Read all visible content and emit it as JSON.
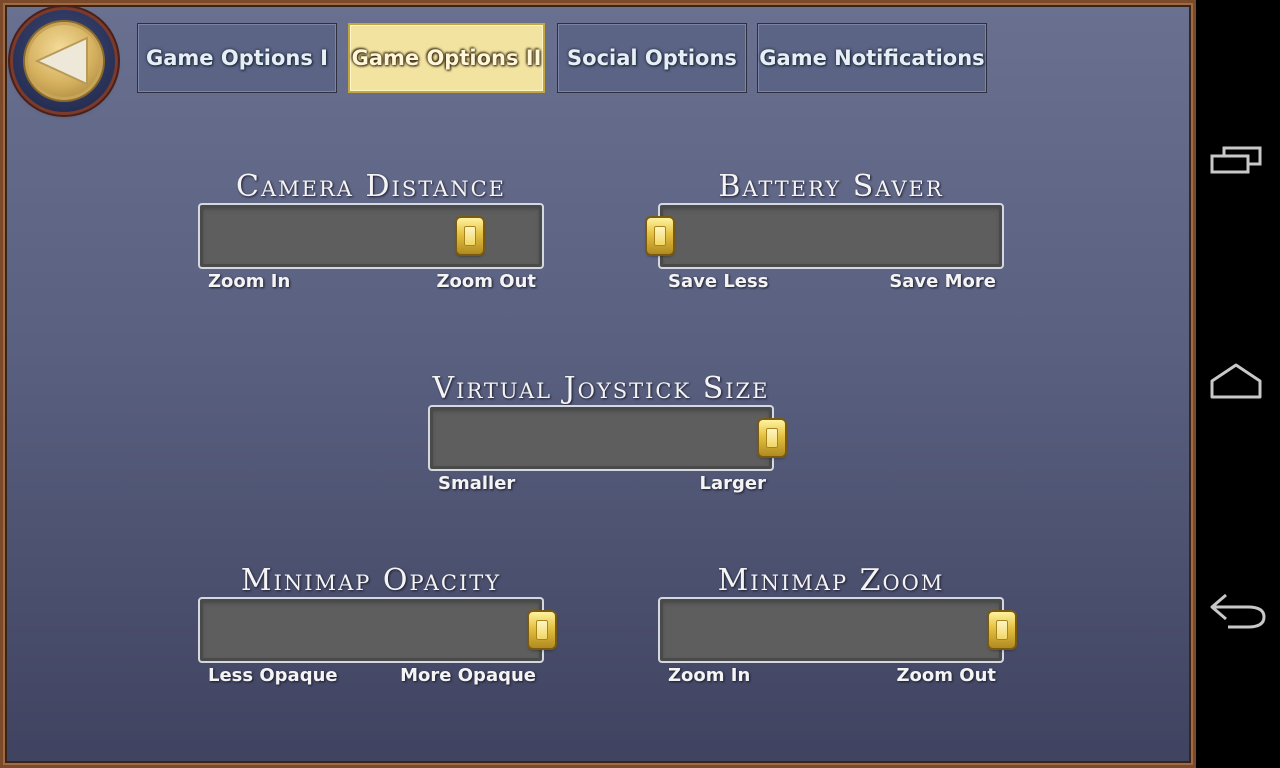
{
  "tabs": [
    {
      "id": "game-options-1",
      "label": "Game Options I",
      "active": false
    },
    {
      "id": "game-options-2",
      "label": "Game Options II",
      "active": true
    },
    {
      "id": "social-options",
      "label": "Social Options",
      "active": false
    },
    {
      "id": "game-notifications",
      "label": "Game Notifications",
      "active": false
    }
  ],
  "sliders": {
    "camera_distance": {
      "title": "Camera Distance",
      "min_label": "Zoom In",
      "max_label": "Zoom Out",
      "value": 0.79
    },
    "battery_saver": {
      "title": "Battery Saver",
      "min_label": "Save Less",
      "max_label": "Save More",
      "value": 0.0
    },
    "virtual_joystick_size": {
      "title": "Virtual Joystick Size",
      "min_label": "Smaller",
      "max_label": "Larger",
      "value": 1.0
    },
    "minimap_opacity": {
      "title": "Minimap Opacity",
      "min_label": "Less Opaque",
      "max_label": "More Opaque",
      "value": 1.0
    },
    "minimap_zoom": {
      "title": "Minimap Zoom",
      "min_label": "Zoom In",
      "max_label": "Zoom Out",
      "value": 1.0
    }
  },
  "icons": {
    "back": "back-arrow-icon",
    "recent_apps": "recent-apps-icon",
    "home": "home-icon",
    "system_back": "system-back-icon"
  },
  "colors": {
    "panel_top": "#6a7090",
    "panel_bottom": "#3f4360",
    "active_tab": "#f2e4a0",
    "thumb_gold": "#e4c040",
    "frame": "#7a4a2a"
  }
}
